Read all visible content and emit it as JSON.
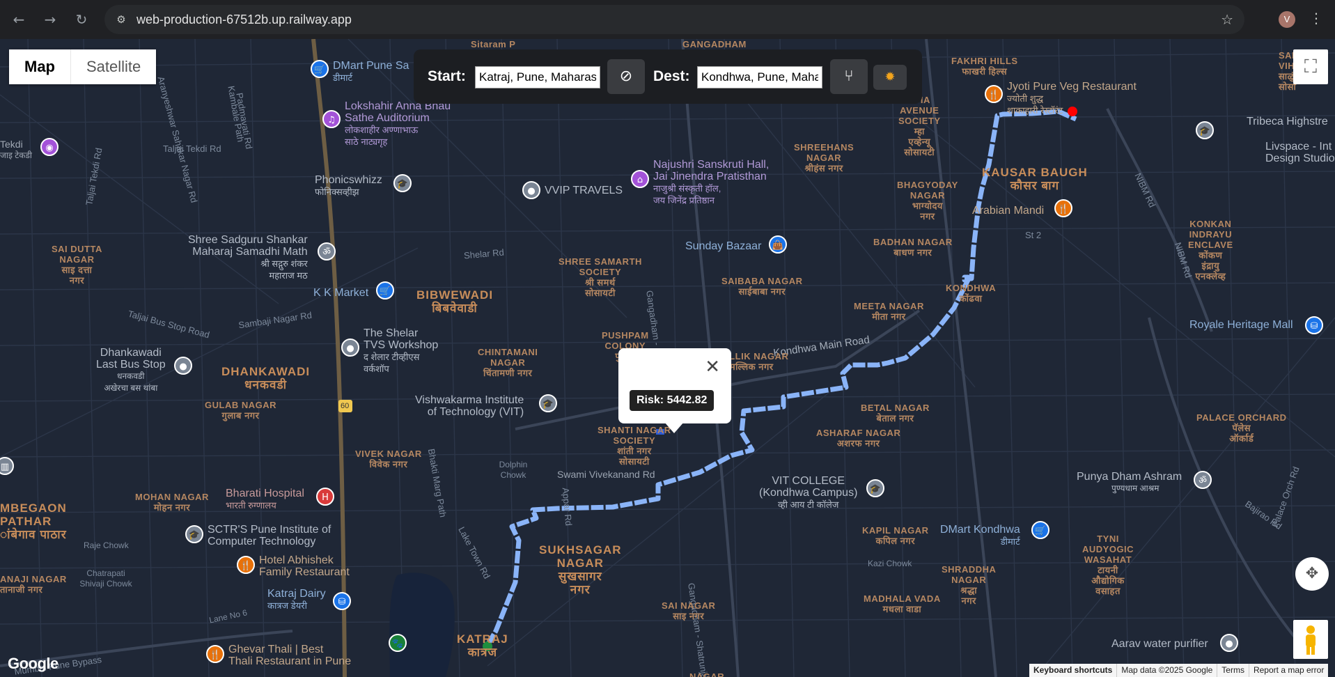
{
  "browser": {
    "url": "web-production-67512b.up.railway.app",
    "avatar_letter": "V"
  },
  "map_type": {
    "map_label": "Map",
    "satellite_label": "Satellite",
    "selected": "Map"
  },
  "route_panel": {
    "start_label": "Start:",
    "start_value": "Katraj, Pune, Maharashtra",
    "dest_label": "Dest:",
    "dest_value": "Kondhwa, Pune, Maharashtra"
  },
  "info_window": {
    "risk_text": "Risk: 5442.82"
  },
  "areas": [
    {
      "id": "bibwewadi",
      "line1": "BIBWEWADI",
      "line2": "बिबवेवाडी"
    },
    {
      "id": "dhankawadi",
      "line1": "DHANKAWADI",
      "line2": "धनकवडी"
    },
    {
      "id": "kausar",
      "line1": "KAUSAR BAUGH",
      "line2": "कौसर बाग"
    },
    {
      "id": "sukhsagar",
      "line1": "SUKHSAGAR",
      "line2": "NAGAR",
      "line3": "सुखसागर",
      "line4": "नगर"
    },
    {
      "id": "katraj",
      "line1": "KATRAJ",
      "line2": "कात्रज"
    },
    {
      "id": "ambegaon",
      "line1": "MBEGAON",
      "line2": "PATHAR",
      "line3": "ांबेगाव पाठार"
    }
  ],
  "small_areas": [
    {
      "id": "saidutta",
      "lines": [
        "SAI DUTTA",
        "NAGAR",
        "साइ दत्ता",
        "नगर"
      ]
    },
    {
      "id": "shreesamarth",
      "lines": [
        "SHREE SAMARTH",
        "SOCIETY",
        "श्री समर्थ",
        "सोसायटी"
      ]
    },
    {
      "id": "chintamani",
      "lines": [
        "CHINTAMANI",
        "NAGAR",
        "चिंतामणी नगर"
      ]
    },
    {
      "id": "pushpam",
      "lines": [
        "PUSHPAM",
        "COLONY",
        "पुष्पम"
      ]
    },
    {
      "id": "mallik",
      "lines": [
        "MALLIK NAGAR",
        "मल्लिक नगर"
      ]
    },
    {
      "id": "shanti",
      "lines": [
        "SHANTI NAGAR",
        "SOCIETY",
        "शांती नगर",
        "सोसायटी"
      ]
    },
    {
      "id": "gulab",
      "lines": [
        "GULAB NAGAR",
        "गुलाब नगर"
      ]
    },
    {
      "id": "vivek",
      "lines": [
        "VIVEK NAGAR",
        "विवेक नगर"
      ]
    },
    {
      "id": "mohan",
      "lines": [
        "MOHAN NAGAR",
        "मोहन नगर"
      ]
    },
    {
      "id": "sainagar",
      "lines": [
        "SAI NAGAR",
        "साइ नगर"
      ]
    },
    {
      "id": "shreehans",
      "lines": [
        "SHREEHANS",
        "NAGAR",
        "श्रीहंस नगर"
      ]
    },
    {
      "id": "saibaba",
      "lines": [
        "SAIBABA NAGAR",
        "साईबाबा नगर"
      ]
    },
    {
      "id": "bhagyoday",
      "lines": [
        "BHAGYODAY",
        "NAGAR",
        "भाग्योदय",
        "नगर"
      ]
    },
    {
      "id": "badhan",
      "lines": [
        "BADHAN NAGAR",
        "बाधण नगर"
      ]
    },
    {
      "id": "meeta",
      "lines": [
        "MEETA NAGAR",
        "मीता नगर"
      ]
    },
    {
      "id": "kondhwa",
      "lines": [
        "KONDHWA",
        "कोंढवा"
      ]
    },
    {
      "id": "betal",
      "lines": [
        "BETAL NAGAR",
        "बेताल नगर"
      ]
    },
    {
      "id": "asharaf",
      "lines": [
        "ASHARAF NAGAR",
        "अशरफ नगर"
      ]
    },
    {
      "id": "kapil",
      "lines": [
        "KAPIL NAGAR",
        "कपिल नगर"
      ]
    },
    {
      "id": "madhala",
      "lines": [
        "MADHALA VADA",
        "मधला वाडा"
      ]
    },
    {
      "id": "shraddha",
      "lines": [
        "SHRADDHA",
        "NAGAR",
        "श्रद्धा",
        "नगर"
      ]
    },
    {
      "id": "fakhri",
      "lines": [
        "FAKHRI HILLS",
        "फाखरी हिल्स"
      ]
    },
    {
      "id": "mha",
      "lines": [
        "MHA",
        "AVENUE",
        "SOCIETY",
        "म्हा",
        "एव्हेन्यू",
        "सोसायटी"
      ]
    },
    {
      "id": "salunke",
      "lines": [
        "SALUNK",
        "VIHAR SC",
        "साळुंके",
        "सोसा"
      ]
    },
    {
      "id": "konkan",
      "lines": [
        "KONKAN",
        "INDRAYU",
        "ENCLAVE",
        "कोंकण",
        "इंद्रायु",
        "एनक्लेव्ह"
      ]
    },
    {
      "id": "palace",
      "lines": [
        "PALACE ORCHARD",
        "पॅलेस",
        "ऑर्कार्ड"
      ]
    },
    {
      "id": "tyni",
      "lines": [
        "TYNI",
        "AUDYOGIC",
        "WASAHAT",
        "टायनी",
        "औद्योगिक",
        "वसाहत"
      ]
    },
    {
      "id": "sitaram",
      "lines": [
        "Sitaram P"
      ]
    },
    {
      "id": "gangadham",
      "lines": [
        "GANGADHAM"
      ]
    },
    {
      "id": "anaji",
      "lines": [
        "ANAJI NAGAR",
        "तानाजी नगर"
      ]
    },
    {
      "id": "bottomnagar",
      "lines": [
        "NAGAR"
      ]
    }
  ],
  "roads": [
    {
      "id": "taljai1",
      "text": "Taljai Tekdi Rd"
    },
    {
      "id": "taljai2",
      "text": "Taljai Tekdi Rd"
    },
    {
      "id": "taljaibus",
      "text": "Taljai Bus Stop Road"
    },
    {
      "id": "sambaji",
      "text": "Sambaji Nagar Rd"
    },
    {
      "id": "shelar",
      "text": "Shelar Rd"
    },
    {
      "id": "kambale",
      "text": "Kambale Path"
    },
    {
      "id": "sahakar",
      "text": "Aranyeshwar Sahakar Nagar Rd"
    },
    {
      "id": "padmavati",
      "text": "Padmavati Rd"
    },
    {
      "id": "bhakti",
      "text": "Bhakti Marg Path"
    },
    {
      "id": "laketown",
      "text": "Lake Town Rd"
    },
    {
      "id": "appar",
      "text": "Appar Rd"
    },
    {
      "id": "vivekanand",
      "text": "Swami Vivekanand Rd"
    },
    {
      "id": "gangadham1",
      "text": "Gangadham - Shatrunjay Rd"
    },
    {
      "id": "gangadham2",
      "text": "Gangadham - Shatrunjay Rd"
    },
    {
      "id": "kondhwamain",
      "text": "Kondhwa Main Road"
    },
    {
      "id": "nibm1",
      "text": "NIBM Rd"
    },
    {
      "id": "nibm2",
      "text": "NIBM Rd"
    },
    {
      "id": "palaceorch",
      "text": "Palace Orch Rd"
    },
    {
      "id": "bajirao",
      "text": "Bajirao Rd"
    },
    {
      "id": "st2",
      "text": "St 2"
    },
    {
      "id": "raje",
      "text": "Raje Chowk"
    },
    {
      "id": "chatrapati",
      "text": "Chatrapati Shivaji Chowk"
    },
    {
      "id": "lane6",
      "text": "Lane No 6"
    },
    {
      "id": "mumbai",
      "text": "Mumbai Pune Bypass"
    },
    {
      "id": "kazi",
      "text": "Kazi Chowk"
    },
    {
      "id": "dolphin",
      "text": "Dolphin Chowk"
    },
    {
      "id": "sixty",
      "text": "60"
    },
    {
      "id": "tekdi",
      "text": "Tekdi"
    },
    {
      "id": "tekdi2",
      "text": "जाइ टेकडी"
    },
    {
      "id": "bharati",
      "text": "Bharati"
    }
  ],
  "pois": [
    {
      "id": "dmart",
      "line1": "DMart Pune Sa",
      "line2": "डीमार्ट",
      "color": "blue"
    },
    {
      "id": "lokshahir",
      "line1": "Lokshahir Anna Bhau",
      "line2": "Sathe Auditorium",
      "line3": "लोकशाहीर अण्णाभाऊ",
      "line4": "साठे नाट्यगृह",
      "color": "purple"
    },
    {
      "id": "phonics",
      "line1": "Phonicswhizz",
      "line2": "फोनिक्सव्हीझ",
      "color": "gray"
    },
    {
      "id": "vvip",
      "line1": "VVIP TRAVELS",
      "color": "gray"
    },
    {
      "id": "najushri",
      "line1": "Najushri Sanskruti Hall,",
      "line2": "Jai Jinendra Pratisthan",
      "line3": "नाजुश्री संस्कृती हॉल,",
      "line4": "जय जिनेंद्र प्रतिष्ठान",
      "color": "purple"
    },
    {
      "id": "shreesadguru",
      "line1": "Shree Sadguru Shankar",
      "line2": "Maharaj Samadhi Math",
      "line3": "श्री सद्गुरु शंकर",
      "line4": "महाराज मठ",
      "color": "gray"
    },
    {
      "id": "sunday",
      "line1": "Sunday Bazaar",
      "color": "blue"
    },
    {
      "id": "kkmarket",
      "line1": "K K Market",
      "color": "blue"
    },
    {
      "id": "shelar",
      "line1": "The Shelar",
      "line2": "TVS Workshop",
      "line3": "द शेलार टीव्हीएस",
      "line4": "वर्कशॉप",
      "color": "gray"
    },
    {
      "id": "dhankawadibus",
      "line1": "Dhankawadi",
      "line2": "Last Bus Stop",
      "line3": "धनकवडी",
      "line4": "अखेरचा बस थांबा",
      "color": "gray"
    },
    {
      "id": "vit",
      "line1": "Vishwakarma Institute",
      "line2": "of Technology (VIT)",
      "color": "gray"
    },
    {
      "id": "bharati",
      "line1": "Bharati Hospital",
      "line2": "भारती रुग्णालय",
      "color": "red"
    },
    {
      "id": "sctr",
      "line1": "SCTR'S Pune Institute of",
      "line2": "Computer Technology",
      "color": "gray"
    },
    {
      "id": "abhishek",
      "line1": "Hotel Abhishek",
      "line2": "Family Restaurant",
      "color": "orange"
    },
    {
      "id": "katrajdairy",
      "line1": "Katraj Dairy",
      "line2": "कात्रज डेयरी",
      "color": "blue"
    },
    {
      "id": "ghevar",
      "line1": "Ghevar Thali | Best",
      "line2": "Thali Restaurant in Pune",
      "color": "orange"
    },
    {
      "id": "vitcollege",
      "line1": "VIT COLLEGE",
      "line2": "(Kondhwa Campus)",
      "line3": "व्ही आय टी कॉलेज",
      "color": "gray"
    },
    {
      "id": "dmartk",
      "line1": "DMart Kondhwa",
      "line2": "डीमार्ट",
      "color": "blue"
    },
    {
      "id": "jyoti",
      "line1": "Jyoti Pure Veg Restaurant",
      "line2": "ज्योती शुद्ध",
      "line3": "शाकाहारी रेस्टॉरंट",
      "color": "orange"
    },
    {
      "id": "arabian",
      "line1": "Arabian Mandi",
      "color": "orange"
    },
    {
      "id": "tribeca",
      "line1": "Tribeca Highstre",
      "color": "gray"
    },
    {
      "id": "livspace",
      "line1": "Livspace - Int",
      "line2": "Design Studio, N",
      "color": "gray"
    },
    {
      "id": "royale",
      "line1": "Royale Heritage Mall",
      "color": "blue"
    },
    {
      "id": "punya",
      "line1": "Punya Dham Ashram",
      "line2": "पुण्यधाम आश्रम",
      "color": "gray"
    },
    {
      "id": "aarav",
      "line1": "Aarav water purifier",
      "color": "gray"
    }
  ],
  "attribution": {
    "google": "Google",
    "shortcuts": "Keyboard shortcuts",
    "mapdata": "Map data ©2025 Google",
    "terms": "Terms",
    "report": "Report a map error"
  },
  "colors": {
    "map_bg": "#1f2736",
    "route": "#8ab4f8",
    "area_label": "#c88d5a",
    "start_marker": "#1e8e3e",
    "end_marker": "#ff0000"
  },
  "icons": [
    "back-icon",
    "forward-icon",
    "reload-icon",
    "site-info-icon",
    "star-icon",
    "menu-icon",
    "compass-icon",
    "route-icon",
    "sun-icon",
    "fullscreen-icon",
    "location-icon",
    "pegman-icon",
    "close-icon"
  ]
}
